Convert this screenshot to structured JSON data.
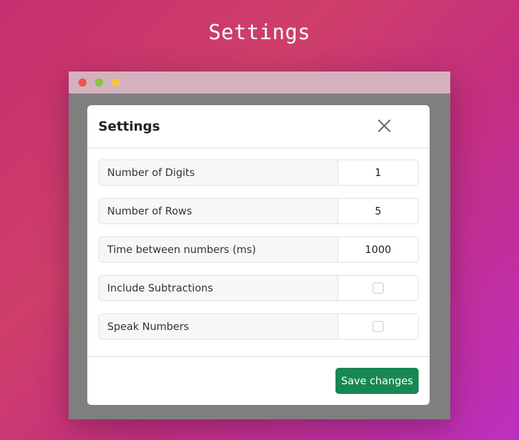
{
  "page": {
    "title": "Settings"
  },
  "window": {
    "controls": [
      "close",
      "minimize",
      "maximize"
    ]
  },
  "modal": {
    "title": "Settings",
    "close_icon": "close-icon",
    "fields": [
      {
        "label": "Number of Digits",
        "type": "text",
        "value": "1"
      },
      {
        "label": "Number of Rows",
        "type": "text",
        "value": "5"
      },
      {
        "label": "Time between numbers (ms)",
        "type": "text",
        "value": "1000"
      },
      {
        "label": "Include Subtractions",
        "type": "checkbox",
        "checked": false
      },
      {
        "label": "Speak Numbers",
        "type": "checkbox",
        "checked": false
      }
    ],
    "save_label": "Save changes"
  },
  "colors": {
    "accent": "#198754",
    "titlebar": "#d5b1bf",
    "window_body": "#7f7f7f",
    "dot_red": "#f0564e",
    "dot_green": "#8cc63f",
    "dot_yellow": "#f6c244"
  }
}
